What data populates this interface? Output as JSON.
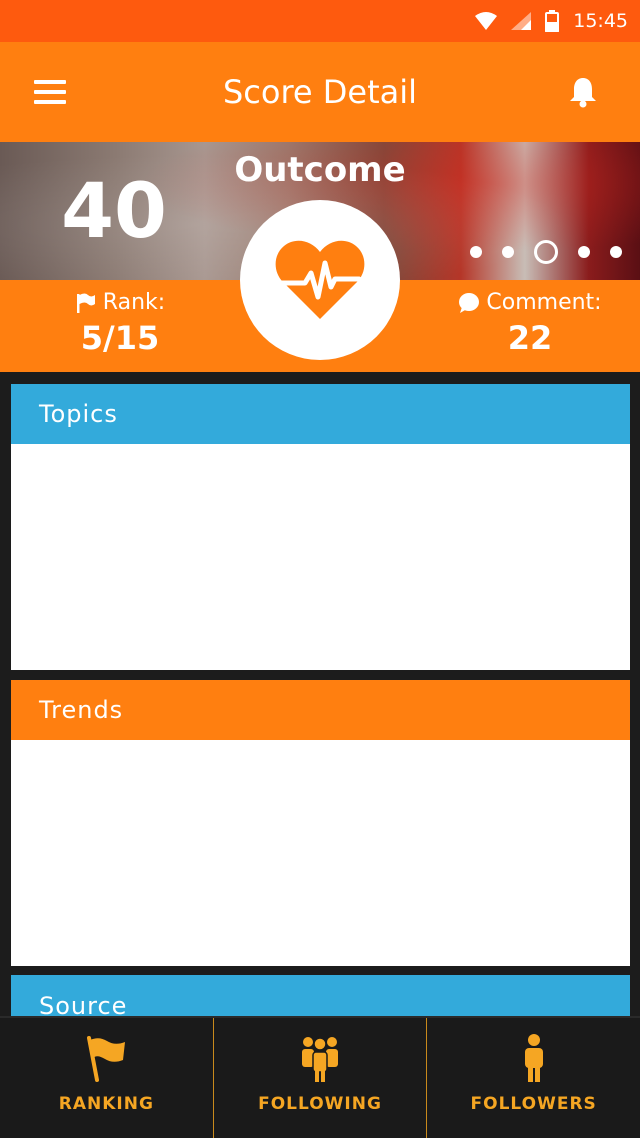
{
  "status_bar": {
    "time": "15:45"
  },
  "app_bar": {
    "title": "Score Detail"
  },
  "hero": {
    "score": "40",
    "category": "Outcome",
    "carousel": {
      "total": 5,
      "active_index": 2
    }
  },
  "stats": {
    "rank_label": "Rank:",
    "rank_value": "5/15",
    "comment_label": "Comment:",
    "comment_value": "22"
  },
  "cards": {
    "topics": "Topics",
    "trends": "Trends",
    "source": "Source"
  },
  "tabs": [
    {
      "label": "RANKING",
      "icon": "flag-icon"
    },
    {
      "label": "FOLLOWING",
      "icon": "group-icon"
    },
    {
      "label": "FOLLOWERS",
      "icon": "person-icon"
    }
  ],
  "colors": {
    "status_bar": "#fe5a0e",
    "accent_orange": "#ff7f10",
    "accent_blue": "#33aadb",
    "tab_text": "#f5a623"
  }
}
